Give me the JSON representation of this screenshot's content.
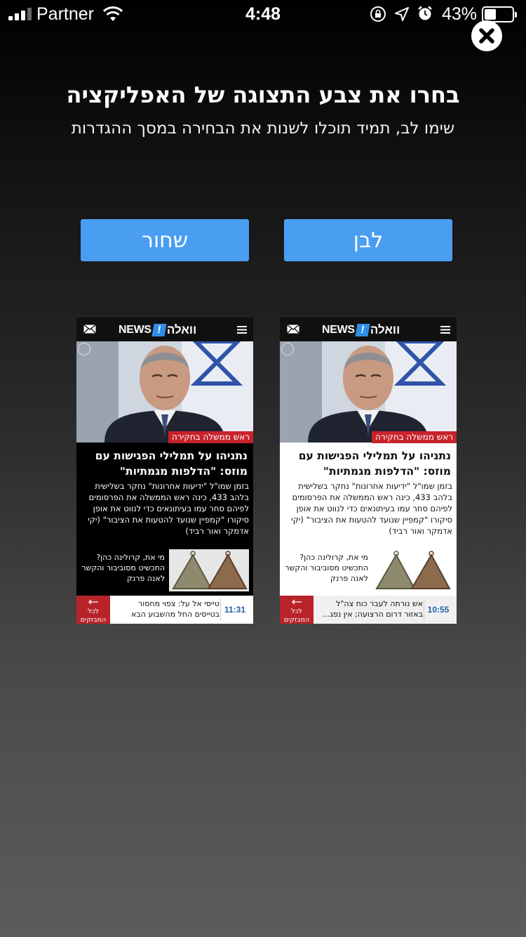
{
  "status_bar": {
    "carrier": "Partner",
    "time": "4:48",
    "battery_percent": "43%",
    "battery_level": 0.43
  },
  "dialog": {
    "title": "בחרו את צבע התצוגה של האפליקציה",
    "subtitle": "שימו לב, תמיד תוכלו לשנות את הבחירה במסך ההגדרות",
    "buttons": {
      "black": "שחור",
      "white": "לבן"
    },
    "accent_color": "#4a9ef2"
  },
  "preview_dark": {
    "logo_news": "NEWS",
    "logo_bang": "!",
    "logo_walla": "וואלה",
    "tag": "ראש ממשלה בחקירה",
    "headline": "נתניהו על תמלילי הפגישות עם מוזס: \"הדלפות מגמתיות\"",
    "body": "בזמן שמו\"ל \"ידיעות אחרונות\" נחקר בשלישית בלהב 433, כינה ראש הממשלה את הפרסומים לפיהם סחר עמו בעיתונאים כדי לנווט את אופן סיקורו \"קמפיין שנועד להטעות את הציבור\" (יקי אדמקר ואור רביד)",
    "teaser": "מי את, קרולינה כהן? התכשיט מסוביבור והקשר לאנה פרנק",
    "flash_time": "11:31",
    "flash_text": "טייסי אל על: צפוי מחסור בטייסים החל מהשבוע הבא",
    "all_flashes": "לכל המבזקים"
  },
  "preview_light": {
    "logo_news": "NEWS",
    "logo_bang": "!",
    "logo_walla": "וואלה",
    "tag": "ראש ממשלה בחקירה",
    "headline": "נתניהו על תמלילי הפגישות עם מוזס: \"הדלפות מגמתיות\"",
    "body": "בזמן שמו\"ל \"ידיעות אחרונות\" נחקר בשלישית בלהב 433, כינה ראש הממשלה את הפרסומים לפיהם סחר עמו בעיתונאים כדי לנווט את אופן סיקורו \"קמפיין שנועד להטעות את הציבור\" (יקי אדמקר ואור רביד)",
    "teaser": "מי את, קרולינה כהן? התכשיט מסוביבור והקשר לאנה פרנק",
    "flash_time": "10:55",
    "flash_text": "אש נורתה לעבר כוח צה\"ל באזור דרום הרצועה; אין נפג...",
    "all_flashes": "לכל המבזקים"
  }
}
